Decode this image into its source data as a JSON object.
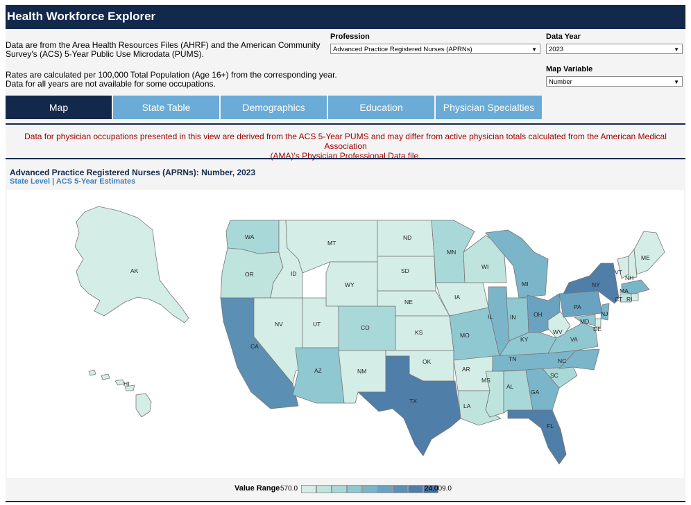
{
  "header": {
    "title": "Health Workforce Explorer"
  },
  "info": {
    "line1": "Data are from the Area Health Resources Files (AHRF) and the American Community",
    "line2": "Survey's (ACS) 5-Year Public Use Microdata (PUMS).",
    "line3": "Rates are calculated per 100,000 Total Population (Age 16+) from the corresponding year.",
    "line4": "Data for all years are not available for some occupations."
  },
  "controls": {
    "profession_label": "Profession",
    "profession_value": "Advanced Practice Registered Nurses (APRNs)",
    "year_label": "Data Year",
    "year_value": "2023",
    "variable_label": "Map Variable",
    "variable_value": "Number"
  },
  "tabs": [
    {
      "label": "Map"
    },
    {
      "label": "State Table"
    },
    {
      "label": "Demographics"
    },
    {
      "label": "Education"
    },
    {
      "label": "Physician Specialties"
    }
  ],
  "notice": {
    "line1": "Data for physician occupations presented in this view are derived from the ACS 5-Year PUMS and may differ from active physician totals calculated from the American Medical Association",
    "line2": "(AMA)'s Physician Professional Data file."
  },
  "map": {
    "title": "Advanced Practice Registered Nurses (APRNs): Number, 2023",
    "subtitle": "State Level | ACS 5-Year Estimates",
    "legend_title": "Value Range",
    "legend_min": "570.0",
    "legend_max": "24,009.0",
    "palette": [
      "#d4ede6",
      "#bfe3dd",
      "#a9d8d8",
      "#90c8d2",
      "#7bb5c9",
      "#6aa3c0",
      "#5b8fb4",
      "#4f7ea8",
      "#476f9c"
    ],
    "states": [
      {
        "id": "AK",
        "label": "AK",
        "bin": 0
      },
      {
        "id": "HI",
        "label": "HI",
        "bin": 0
      },
      {
        "id": "WA",
        "label": "WA",
        "bin": 2
      },
      {
        "id": "OR",
        "label": "OR",
        "bin": 1
      },
      {
        "id": "CA",
        "label": "CA",
        "bin": 6
      },
      {
        "id": "NV",
        "label": "NV",
        "bin": 0
      },
      {
        "id": "ID",
        "label": "ID",
        "bin": 0
      },
      {
        "id": "MT",
        "label": "MT",
        "bin": 0
      },
      {
        "id": "WY",
        "label": "WY",
        "bin": 0
      },
      {
        "id": "UT",
        "label": "UT",
        "bin": 0
      },
      {
        "id": "AZ",
        "label": "AZ",
        "bin": 3
      },
      {
        "id": "NM",
        "label": "NM",
        "bin": 0
      },
      {
        "id": "CO",
        "label": "CO",
        "bin": 2
      },
      {
        "id": "ND",
        "label": "ND",
        "bin": 0
      },
      {
        "id": "SD",
        "label": "SD",
        "bin": 0
      },
      {
        "id": "NE",
        "label": "NE",
        "bin": 0
      },
      {
        "id": "KS",
        "label": "KS",
        "bin": 0
      },
      {
        "id": "OK",
        "label": "OK",
        "bin": 0
      },
      {
        "id": "TX",
        "label": "TX",
        "bin": 7
      },
      {
        "id": "MN",
        "label": "MN",
        "bin": 2
      },
      {
        "id": "IA",
        "label": "IA",
        "bin": 0
      },
      {
        "id": "MO",
        "label": "MO",
        "bin": 3
      },
      {
        "id": "AR",
        "label": "AR",
        "bin": 0
      },
      {
        "id": "LA",
        "label": "LA",
        "bin": 1
      },
      {
        "id": "WI",
        "label": "WI",
        "bin": 1
      },
      {
        "id": "IL",
        "label": "IL",
        "bin": 4
      },
      {
        "id": "MI",
        "label": "MI",
        "bin": 4
      },
      {
        "id": "IN",
        "label": "IN",
        "bin": 3
      },
      {
        "id": "OH",
        "label": "OH",
        "bin": 5
      },
      {
        "id": "KY",
        "label": "KY",
        "bin": 3
      },
      {
        "id": "TN",
        "label": "TN",
        "bin": 4
      },
      {
        "id": "MS",
        "label": "MS",
        "bin": 1
      },
      {
        "id": "AL",
        "label": "AL",
        "bin": 2
      },
      {
        "id": "GA",
        "label": "GA",
        "bin": 4
      },
      {
        "id": "FL",
        "label": "FL",
        "bin": 7
      },
      {
        "id": "SC",
        "label": "SC",
        "bin": 2
      },
      {
        "id": "NC",
        "label": "NC",
        "bin": 4
      },
      {
        "id": "VA",
        "label": "VA",
        "bin": 3
      },
      {
        "id": "WV",
        "label": "WV",
        "bin": 0
      },
      {
        "id": "PA",
        "label": "PA",
        "bin": 5
      },
      {
        "id": "NY",
        "label": "NY",
        "bin": 7
      },
      {
        "id": "ME",
        "label": "ME",
        "bin": 0
      },
      {
        "id": "VT",
        "label": "VT",
        "bin": 0
      },
      {
        "id": "NH",
        "label": "NH",
        "bin": 0
      },
      {
        "id": "MA",
        "label": "MA",
        "bin": 4
      },
      {
        "id": "CT",
        "label": "CT",
        "bin": 1
      },
      {
        "id": "RI",
        "label": "RI",
        "bin": 0
      },
      {
        "id": "NJ",
        "label": "NJ",
        "bin": 4
      },
      {
        "id": "DE",
        "label": "DE",
        "bin": 0
      },
      {
        "id": "MD",
        "label": "MD",
        "bin": 3
      }
    ]
  }
}
